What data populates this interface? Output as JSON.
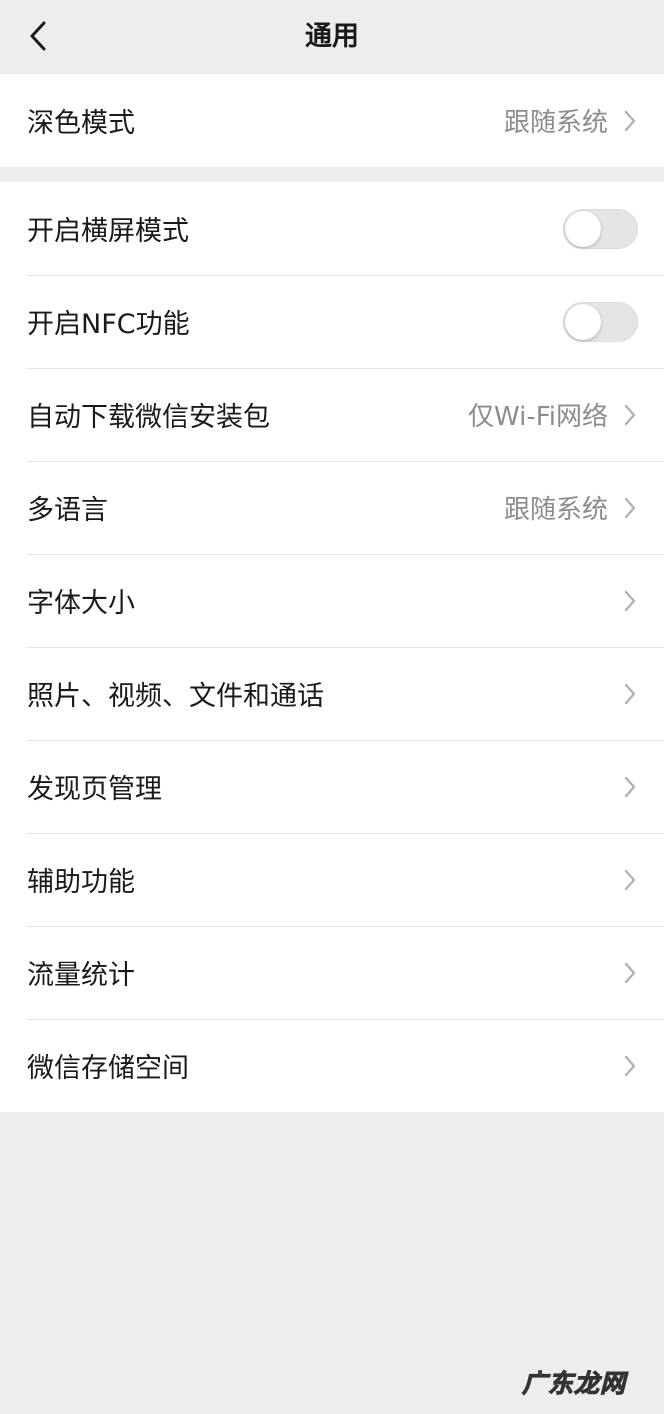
{
  "header": {
    "title": "通用",
    "back_icon": "chevron-left-icon"
  },
  "colors": {
    "background": "#ededed",
    "card": "#ffffff",
    "secondary_text": "#8c8c8c",
    "toggle_off": "#e5e5e5"
  },
  "group1": {
    "dark_mode": {
      "label": "深色模式",
      "value": "跟随系统"
    }
  },
  "group2": {
    "landscape": {
      "label": "开启横屏模式",
      "enabled": false
    },
    "nfc": {
      "label": "开启NFC功能",
      "enabled": false
    },
    "auto_download": {
      "label": "自动下载微信安装包",
      "value": "仅Wi-Fi网络"
    },
    "language": {
      "label": "多语言",
      "value": "跟随系统"
    },
    "font_size": {
      "label": "字体大小"
    },
    "media": {
      "label": "照片、视频、文件和通话"
    },
    "discover": {
      "label": "发现页管理"
    },
    "accessibility": {
      "label": "辅助功能"
    },
    "traffic": {
      "label": "流量统计"
    },
    "storage": {
      "label": "微信存储空间"
    }
  },
  "watermark": "广东龙网"
}
